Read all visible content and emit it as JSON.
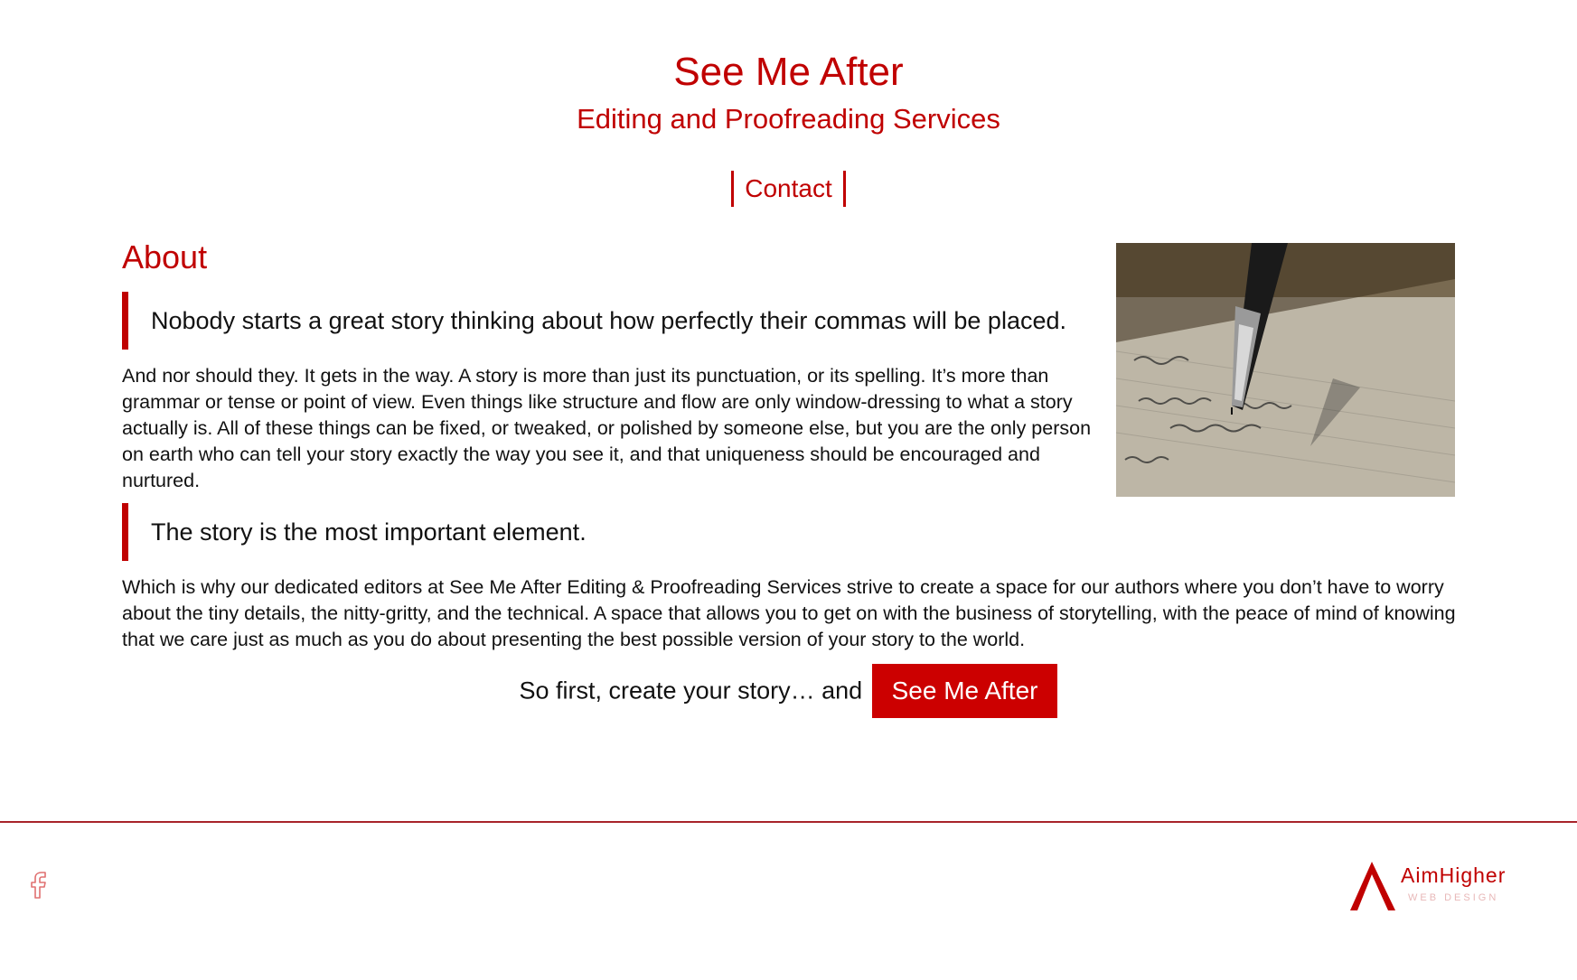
{
  "header": {
    "title": "See Me After",
    "subtitle": "Editing and Proofreading Services"
  },
  "nav": {
    "items": [
      {
        "label": "Contact"
      }
    ]
  },
  "about": {
    "heading": "About",
    "quote_1": "Nobody starts a great story thinking about how perfectly their commas will be placed.",
    "paragraph_1": "And nor should they. It gets in the way. A story is more than just its punctuation, or its spelling. It’s more than grammar or tense or point of view. Even things like structure and flow are only window-dressing to what a story actually is. All of these things can be fixed, or tweaked, or polished by someone else, but you are the only person on earth who can tell your story exactly the way you see it, and that uniqueness should be encouraged and nurtured.",
    "quote_2": "The story is the most important element.",
    "paragraph_2": "Which is why our dedicated editors at See Me After Editing & Proofreading Services strive to create a space for our authors where you don’t have to worry about the tiny details, the nitty-gritty, and the technical. A space that allows you to get on with the business of storytelling, with the peace of mind of knowing that we care just as much as you do about presenting the best possible version of your story to the world.",
    "image_icon": "fountain-pen-writing-image"
  },
  "cta": {
    "text": "So first, create your story… and",
    "button_label": "See Me After"
  },
  "footer": {
    "social_icon": "facebook-icon",
    "logo_name": "AimHigher",
    "logo_tagline": "WEB DESIGN"
  },
  "colors": {
    "accent": "#c00000",
    "button": "#cc0000",
    "divider": "#a8242a"
  }
}
